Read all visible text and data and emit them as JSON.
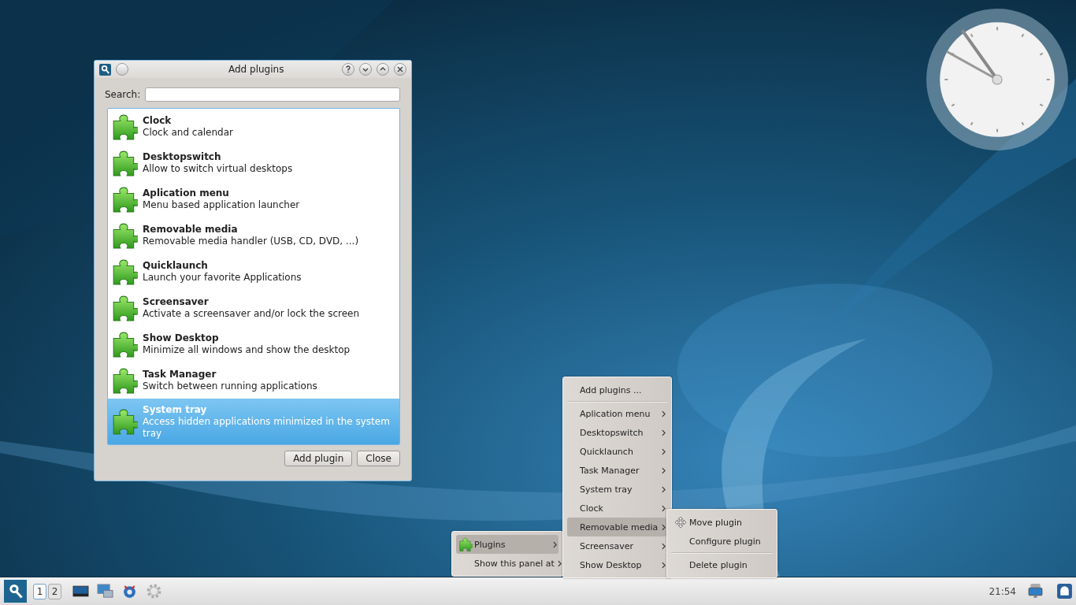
{
  "dialog": {
    "title": "Add plugins",
    "search_label": "Search:",
    "plugins": [
      {
        "name": "Clock",
        "description": "Clock and calendar",
        "selected": false
      },
      {
        "name": "Desktopswitch",
        "description": "Allow to switch virtual desktops",
        "selected": false
      },
      {
        "name": "Aplication menu",
        "description": "Menu based application launcher",
        "selected": false
      },
      {
        "name": "Removable media",
        "description": "Removable media handler (USB, CD, DVD, ...)",
        "selected": false
      },
      {
        "name": "Quicklaunch",
        "description": "Launch your favorite Applications",
        "selected": false
      },
      {
        "name": "Screensaver",
        "description": "Activate a screensaver and/or lock the screen",
        "selected": false
      },
      {
        "name": "Show Desktop",
        "description": "Minimize all windows and show the desktop",
        "selected": false
      },
      {
        "name": "Task Manager",
        "description": "Switch between running applications",
        "selected": false
      },
      {
        "name": "System tray",
        "description": "Access hidden applications minimized in the system tray",
        "selected": true
      }
    ],
    "buttons": [
      "Add plugin",
      "Close"
    ]
  },
  "panel_menu": [
    {
      "label": "Plugins",
      "selected": true,
      "kind": "submenu"
    },
    {
      "label": "Show this panel at",
      "selected": false,
      "kind": "submenu"
    }
  ],
  "plugins_menu": [
    {
      "label": "Add plugins ...",
      "selected": false,
      "kind": "action"
    },
    {
      "kind": "separator"
    },
    {
      "label": "Aplication menu",
      "selected": false,
      "kind": "submenu"
    },
    {
      "label": "Desktopswitch",
      "selected": false,
      "kind": "submenu"
    },
    {
      "label": "Quicklaunch",
      "selected": false,
      "kind": "submenu"
    },
    {
      "label": "Task Manager",
      "selected": false,
      "kind": "submenu"
    },
    {
      "label": "System tray",
      "selected": false,
      "kind": "submenu"
    },
    {
      "label": "Clock",
      "selected": false,
      "kind": "submenu"
    },
    {
      "label": "Removable media",
      "selected": true,
      "kind": "submenu"
    },
    {
      "label": "Screensaver",
      "selected": false,
      "kind": "submenu"
    },
    {
      "label": "Show Desktop",
      "selected": false,
      "kind": "submenu"
    }
  ],
  "plugin_submenu": [
    {
      "label": "Move plugin",
      "selected": false,
      "kind": "move"
    },
    {
      "label": "Configure plugin",
      "selected": false,
      "kind": "action"
    },
    {
      "kind": "separator"
    },
    {
      "label": "Delete plugin",
      "selected": false,
      "kind": "action"
    }
  ],
  "taskbar": {
    "desktops": [
      {
        "label": "1",
        "selected": true
      },
      {
        "label": "2",
        "selected": false
      }
    ],
    "time": "21:54"
  }
}
